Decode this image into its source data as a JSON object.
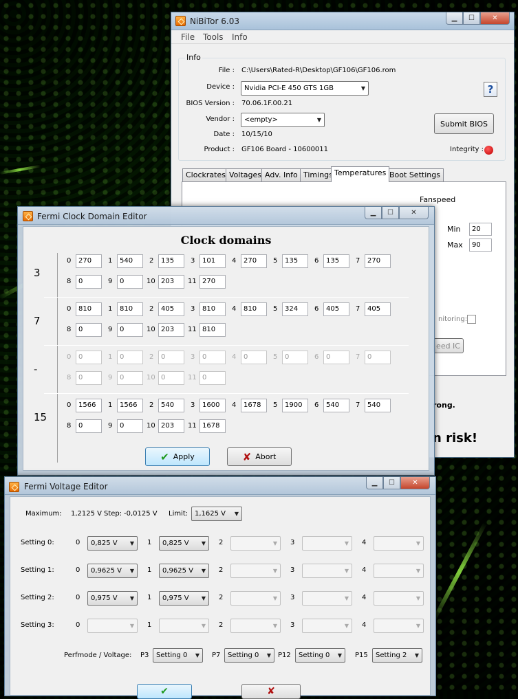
{
  "nibitor": {
    "title": "NiBiTor 6.03",
    "menu": [
      "File",
      "Tools",
      "Info"
    ],
    "info_group": "Info",
    "file_label": "File :",
    "file_value": "C:\\Users\\Rated-R\\Desktop\\GF106\\GF106.rom",
    "device_label": "Device :",
    "device_value": "Nvidia PCI-E 450 GTS 1GB",
    "bios_version_label": "BIOS Version :",
    "bios_version_value": "70.06.1F.00.21",
    "vendor_label": "Vendor :",
    "vendor_value": "<empty>",
    "date_label": "Date :",
    "date_value": "10/15/10",
    "product_label": "Product :",
    "product_value": "GF106 Board - 10600011",
    "help_label": "?",
    "submit_label": "Submit BIOS",
    "integrity_label": "Integrity :",
    "integrity_color": "#d00000",
    "tabs": [
      "Clockrates",
      "Voltages",
      "Adv. Info",
      "Timings",
      "Temperatures",
      "Boot Settings"
    ],
    "active_tab": "Temperatures",
    "fanspeed_label": "Fanspeed",
    "min_label": "Min",
    "min_value": "20",
    "max_label": "Max",
    "max_value": "90",
    "monitoring_label": "nitoring:",
    "speed_ic_label": "eed IC",
    "warning_text": "rong.",
    "risk_text": "n risk!"
  },
  "clock_editor": {
    "title": "Fermi Clock Domain Editor",
    "heading": "Clock domains",
    "groups": [
      {
        "label": "3",
        "disabled": false,
        "values": [
          "270",
          "540",
          "135",
          "101",
          "270",
          "135",
          "135",
          "270",
          "0",
          "0",
          "203",
          "270"
        ]
      },
      {
        "label": "7",
        "disabled": false,
        "values": [
          "810",
          "810",
          "405",
          "810",
          "810",
          "324",
          "405",
          "405",
          "0",
          "0",
          "203",
          "810"
        ]
      },
      {
        "label": "-",
        "disabled": true,
        "values": [
          "0",
          "0",
          "0",
          "0",
          "0",
          "0",
          "0",
          "0",
          "0",
          "0",
          "0",
          "0"
        ]
      },
      {
        "label": "15",
        "disabled": false,
        "values": [
          "1566",
          "1566",
          "540",
          "1600",
          "1678",
          "1900",
          "540",
          "540",
          "0",
          "0",
          "203",
          "1678"
        ]
      }
    ],
    "indices": [
      "0",
      "1",
      "2",
      "3",
      "4",
      "5",
      "6",
      "7",
      "8",
      "9",
      "10",
      "11"
    ],
    "apply_label": "Apply",
    "abort_label": "Abort",
    "apply_icon": "check-icon",
    "abort_icon": "x-icon"
  },
  "voltage_editor": {
    "title": "Fermi Voltage Editor",
    "maximum_label": "Maximum:",
    "maximum_value": "1,2125 V",
    "step_label": "Step:",
    "step_value": "-0,0125 V",
    "limit_label": "Limit:",
    "limit_value": "1,1625 V",
    "indices": [
      "0",
      "1",
      "2",
      "3",
      "4"
    ],
    "settings": [
      {
        "label": "Setting 0:",
        "values": [
          "0,825 V",
          "0,825 V",
          "",
          "",
          ""
        ]
      },
      {
        "label": "Setting 1:",
        "values": [
          "0,9625 V",
          "0,9625 V",
          "",
          "",
          ""
        ]
      },
      {
        "label": "Setting 2:",
        "values": [
          "0,975 V",
          "0,975 V",
          "",
          "",
          ""
        ]
      },
      {
        "label": "Setting 3:",
        "values": [
          "",
          "",
          "",
          "",
          ""
        ]
      }
    ],
    "perfmode_label": "Perfmode / Voltage:",
    "perfmodes": [
      {
        "label": "P3",
        "value": "Setting 0"
      },
      {
        "label": "P7",
        "value": "Setting 0"
      },
      {
        "label": "P12",
        "value": "Setting 0"
      },
      {
        "label": "P15",
        "value": "Setting 2"
      }
    ]
  }
}
